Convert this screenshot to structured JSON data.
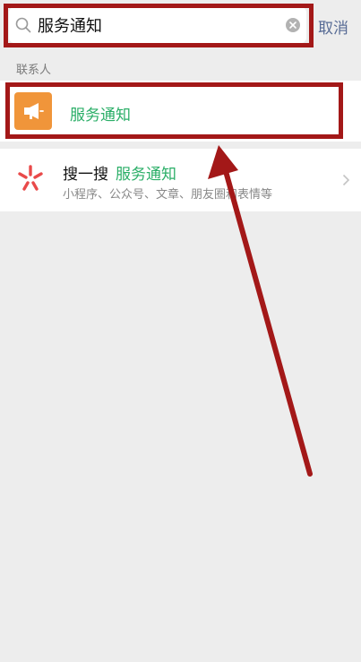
{
  "search": {
    "query": "服务通知",
    "cancel_label": "取消"
  },
  "contacts_section": {
    "header": "联系人",
    "items": [
      {
        "name": "服务通知",
        "avatar_icon": "megaphone-icon",
        "avatar_color": "#f0953a"
      }
    ]
  },
  "sousou": {
    "label": "搜一搜",
    "keyword": "服务通知",
    "subtitle": "小程序、公众号、文章、朋友圈和表情等",
    "logo_icon": "sousou-logo-icon"
  },
  "colors": {
    "accent_green": "#2aae67",
    "link_blue": "#576b95",
    "annotation_red": "#a31818",
    "background": "#ededed"
  }
}
